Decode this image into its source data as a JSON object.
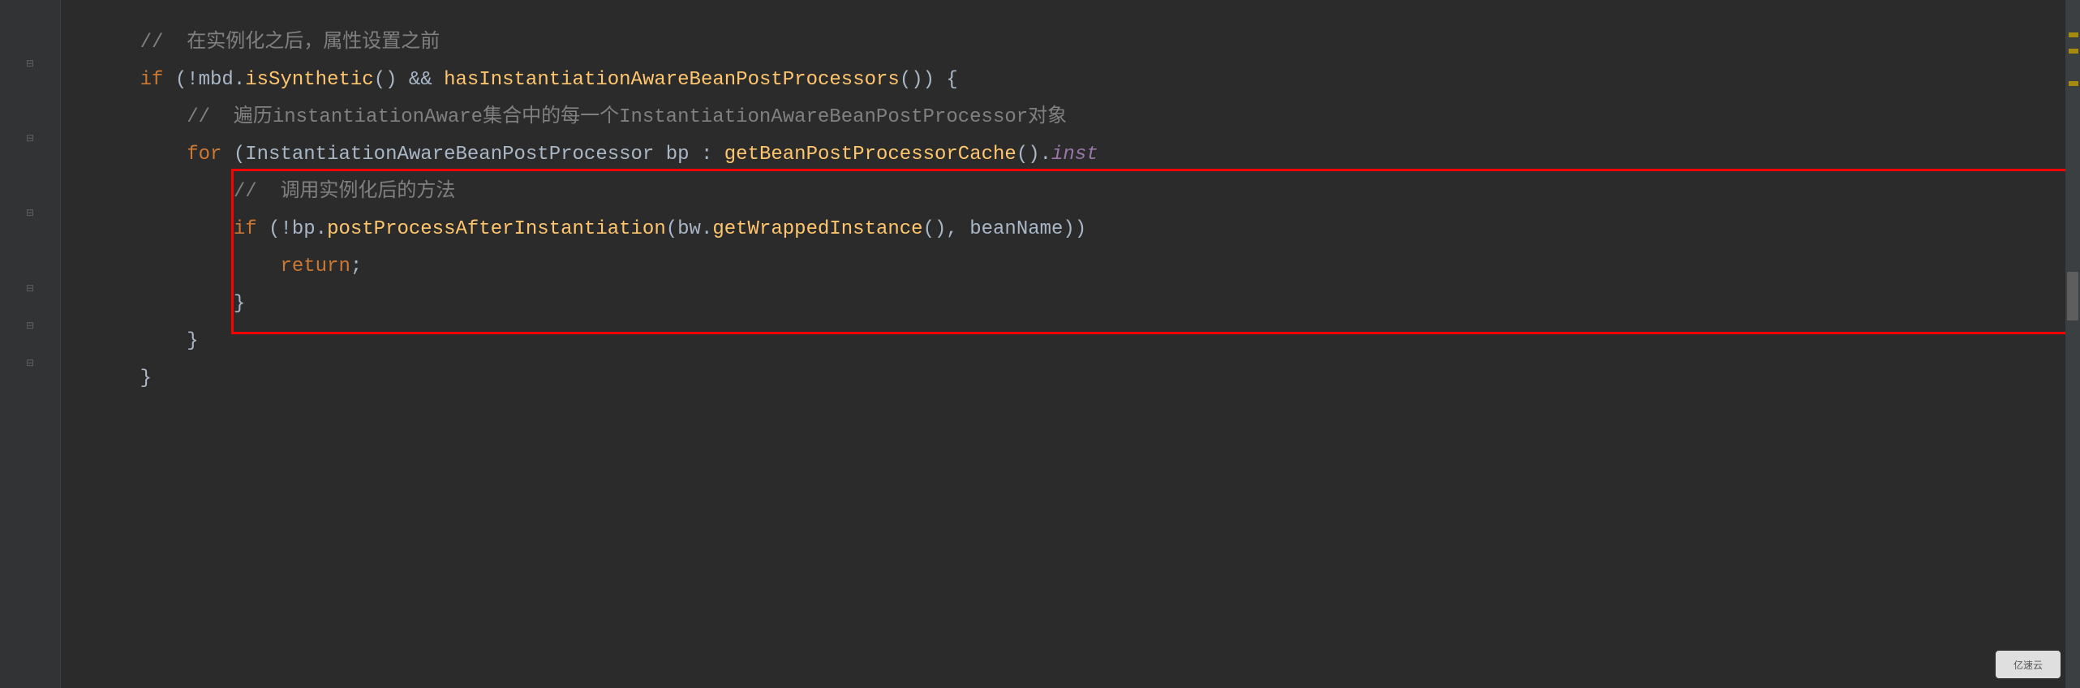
{
  "code": {
    "line1_comment": "//  在实例化之后，属性设置之前",
    "line2_if": "if",
    "line2_cond_open": " (!mbd.",
    "line2_method1": "isSynthetic",
    "line2_mid": "() && ",
    "line2_method2": "hasInstantiationAwareBeanPostProcessors",
    "line2_end": "()) {",
    "line3_comment": "//  遍历instantiationAware集合中的每一个InstantiationAwareBeanPostProcessor对象",
    "line4_for": "for",
    "line4_paren": " (",
    "line4_type": "InstantiationAwareBeanPostProcessor bp : ",
    "line4_method": "getBeanPostProcessorCache",
    "line4_dot": "().",
    "line4_trail": "inst",
    "line5_comment": "//  调用实例化后的方法",
    "line6_if": "if",
    "line6_open": " (!bp.",
    "line6_method1": "postProcessAfterInstantiation",
    "line6_mid1": "(bw.",
    "line6_method2": "getWrappedInstance",
    "line6_mid2": "(), beanName)) ",
    "line7_return": "return",
    "line7_semi": ";",
    "line8_brace": "}",
    "line9_brace": "}",
    "line10_brace": "}"
  },
  "watermark": "亿速云"
}
